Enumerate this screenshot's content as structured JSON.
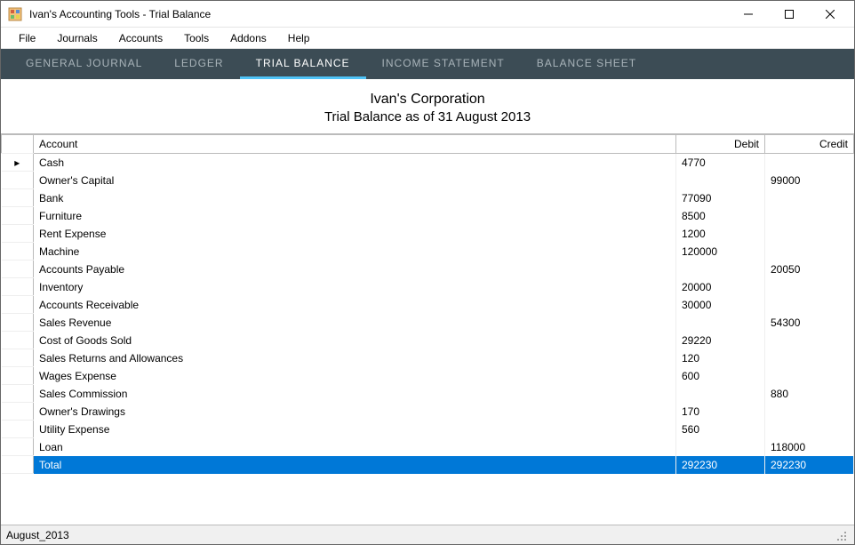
{
  "window": {
    "title": "Ivan's Accounting Tools - Trial Balance"
  },
  "menu": {
    "items": [
      "File",
      "Journals",
      "Accounts",
      "Tools",
      "Addons",
      "Help"
    ]
  },
  "tabs": {
    "items": [
      {
        "label": "General Journal",
        "active": false
      },
      {
        "label": "Ledger",
        "active": false
      },
      {
        "label": "Trial Balance",
        "active": true
      },
      {
        "label": "Income Statement",
        "active": false
      },
      {
        "label": "Balance Sheet",
        "active": false
      }
    ]
  },
  "report": {
    "company": "Ivan's Corporation",
    "subtitle": "Trial Balance as of 31 August 2013"
  },
  "columns": {
    "account": "Account",
    "debit": "Debit",
    "credit": "Credit"
  },
  "rows": [
    {
      "marker": "▸",
      "account": "Cash",
      "debit": "4770",
      "credit": ""
    },
    {
      "marker": "",
      "account": "Owner's Capital",
      "debit": "",
      "credit": "99000"
    },
    {
      "marker": "",
      "account": "Bank",
      "debit": "77090",
      "credit": ""
    },
    {
      "marker": "",
      "account": "Furniture",
      "debit": "8500",
      "credit": ""
    },
    {
      "marker": "",
      "account": "Rent Expense",
      "debit": "1200",
      "credit": ""
    },
    {
      "marker": "",
      "account": "Machine",
      "debit": "120000",
      "credit": ""
    },
    {
      "marker": "",
      "account": "Accounts Payable",
      "debit": "",
      "credit": "20050"
    },
    {
      "marker": "",
      "account": "Inventory",
      "debit": "20000",
      "credit": ""
    },
    {
      "marker": "",
      "account": "Accounts Receivable",
      "debit": "30000",
      "credit": ""
    },
    {
      "marker": "",
      "account": "Sales Revenue",
      "debit": "",
      "credit": "54300"
    },
    {
      "marker": "",
      "account": "Cost of Goods Sold",
      "debit": "29220",
      "credit": ""
    },
    {
      "marker": "",
      "account": "Sales Returns and Allowances",
      "debit": "120",
      "credit": ""
    },
    {
      "marker": "",
      "account": "Wages Expense",
      "debit": "600",
      "credit": ""
    },
    {
      "marker": "",
      "account": "Sales Commission",
      "debit": "",
      "credit": "880"
    },
    {
      "marker": "",
      "account": "Owner's Drawings",
      "debit": "170",
      "credit": ""
    },
    {
      "marker": "",
      "account": "Utility Expense",
      "debit": "560",
      "credit": ""
    },
    {
      "marker": "",
      "account": "Loan",
      "debit": "",
      "credit": "118000"
    }
  ],
  "total": {
    "label": "Total",
    "debit": "292230",
    "credit": "292230"
  },
  "status": {
    "text": "August_2013"
  }
}
